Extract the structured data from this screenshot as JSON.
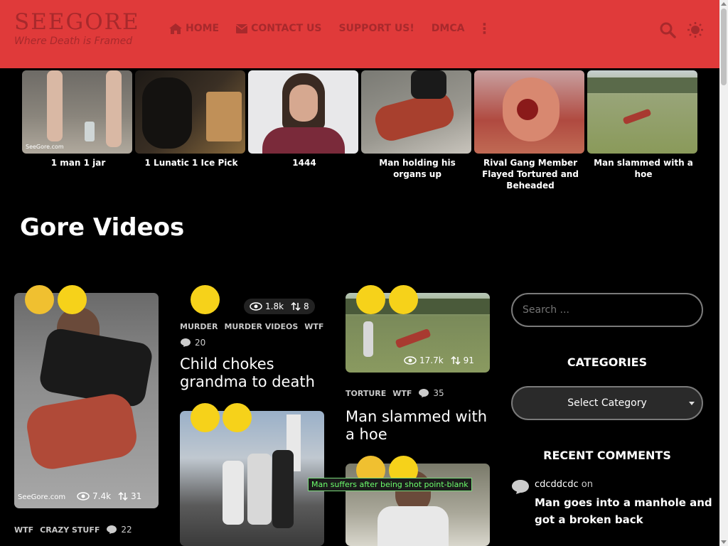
{
  "header": {
    "site_title": "SEEGORE",
    "tagline": "Where Death is Framed",
    "nav": [
      {
        "label": "HOME",
        "icon": "home-icon"
      },
      {
        "label": "CONTACT US",
        "icon": "envelope-icon"
      },
      {
        "label": "SUPPORT US!",
        "icon": ""
      },
      {
        "label": "DMCA",
        "icon": ""
      }
    ],
    "more_icon": "⋮",
    "search_icon": "search-icon",
    "theme_icon": "sun-icon"
  },
  "strip": [
    {
      "caption": "1 man 1 jar"
    },
    {
      "caption": "1 Lunatic 1 Ice Pick"
    },
    {
      "caption": "1444"
    },
    {
      "caption": "Man holding his organs up"
    },
    {
      "caption": "Rival Gang Member Flayed Tortured and Beheaded"
    },
    {
      "caption": "Man slammed with a hoe"
    }
  ],
  "watermark": "SeeGore.com",
  "section_title": "Gore Videos",
  "posts": [
    {
      "views": "7.4k",
      "votes": "31",
      "tags": [
        "WTF",
        "CRAZY STUFF"
      ],
      "comments": "22",
      "title": ""
    },
    {
      "views": "1.8k",
      "votes": "8",
      "tags": [
        "MURDER",
        "MURDER VIDEOS",
        "WTF"
      ],
      "comments": "20",
      "title": "Child chokes grandma to death"
    },
    {
      "views": "17.7k",
      "votes": "91",
      "tags": [
        "TORTURE",
        "WTF"
      ],
      "comments": "35",
      "title": "Man slammed with a hoe"
    }
  ],
  "tooltip": "Man suffers after being shot point-blank",
  "sidebar": {
    "search_placeholder": "Search ...",
    "categories_heading": "CATEGORIES",
    "category_select": "Select Category",
    "recent_heading": "RECENT COMMENTS",
    "comment": {
      "author": "cdcddcdc",
      "on": "on",
      "post": "Man goes into a manhole and got a broken back"
    }
  },
  "colors": {
    "header_bg": "#e03a3a",
    "header_text": "#a8292c",
    "page_bg": "#000000",
    "tooltip_text": "#6dff6d"
  }
}
